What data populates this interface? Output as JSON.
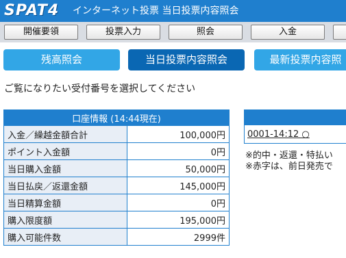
{
  "header": {
    "logo": "SPAT4",
    "title": "インターネット投票 当日投票内容照会"
  },
  "topnav": [
    "開催要領",
    "投票入力",
    "照会",
    "入金",
    ""
  ],
  "subnav": [
    "残高照会",
    "当日投票内容照会",
    "最新投票内容照"
  ],
  "instruction": "ご覧になりたい受付番号を選択してください",
  "account": {
    "heading": "口座情報 (14:44現在)",
    "rows": [
      {
        "label": "入金／繰越金額合計",
        "value": "100,000円"
      },
      {
        "label": "ポイント入金額",
        "value": "0円"
      },
      {
        "label": "当日購入金額",
        "value": "50,000円"
      },
      {
        "label": "当日払戻／返還金額",
        "value": "145,000円"
      },
      {
        "label": "当日精算金額",
        "value": "0円"
      },
      {
        "label": "購入限度額",
        "value": "195,000円"
      },
      {
        "label": "購入可能件数",
        "value": "2999件"
      }
    ]
  },
  "receipts": {
    "items": [
      "0001-14:12 ○"
    ],
    "notes": [
      "※的中・返還・特払い",
      "※赤字は、前日発売で"
    ]
  },
  "colors": {
    "header_blue": "#1f7fce",
    "button_light": "#32a6e6",
    "button_dark": "#0a67b3"
  }
}
